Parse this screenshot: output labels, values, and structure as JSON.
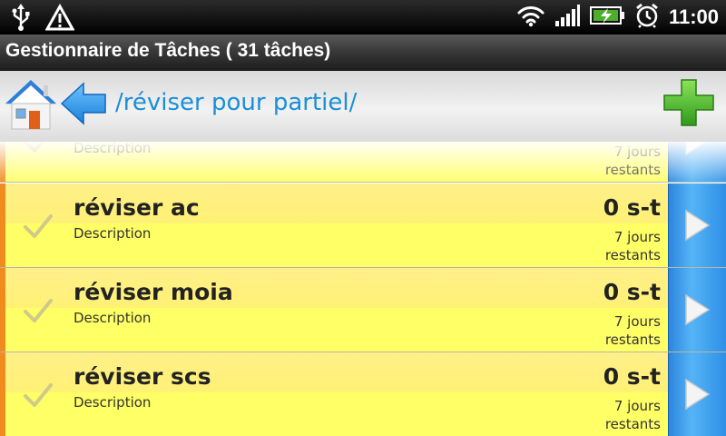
{
  "status_bar": {
    "time": "11:00",
    "icons": [
      "usb-icon",
      "warning-icon",
      "wifi-icon",
      "signal-icon",
      "battery-charging-icon",
      "alarm-icon"
    ]
  },
  "title_bar": {
    "title": "Gestionnaire de Tâches ( 31 tâches)"
  },
  "toolbar": {
    "path": "/réviser pour partiel/",
    "icons": [
      "home-icon",
      "back-arrow-icon",
      "add-icon"
    ]
  },
  "tasks": [
    {
      "title": "",
      "description": "Description",
      "value": "",
      "remaining_1": "7 jours",
      "remaining_2": "restants"
    },
    {
      "title": "réviser ac",
      "description": "Description",
      "value": "0 s-t",
      "remaining_1": "7 jours",
      "remaining_2": "restants"
    },
    {
      "title": "réviser moia",
      "description": "Description",
      "value": "0 s-t",
      "remaining_1": "7 jours",
      "remaining_2": "restants"
    },
    {
      "title": "réviser scs",
      "description": "Description",
      "value": "0 s-t",
      "remaining_1": "7 jours",
      "remaining_2": "restants"
    }
  ],
  "colors": {
    "row_bg": "#ffff66",
    "row_accent": "#f08b1e",
    "arrow_bg": "#3a9ff0",
    "path_text": "#1a8fd8"
  }
}
